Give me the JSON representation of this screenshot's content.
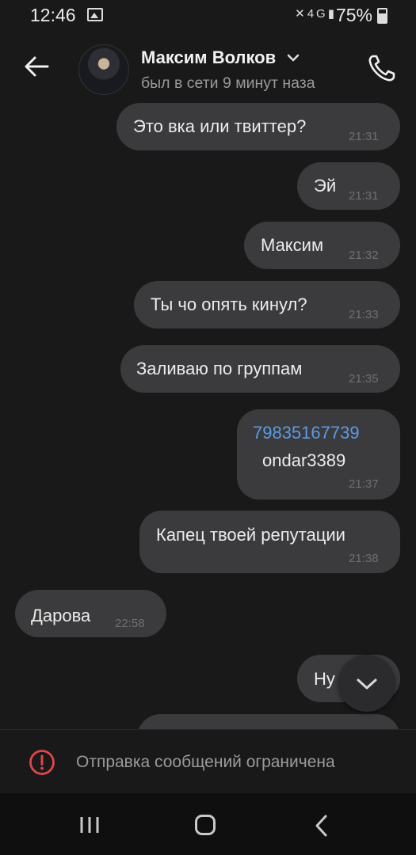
{
  "status_bar": {
    "time": "12:46",
    "network": "4G",
    "battery": "75%"
  },
  "header": {
    "contact_name": "Максим Волков",
    "contact_status": "был в сети 9 минут наза"
  },
  "messages": [
    {
      "text": "Это вка или твиттер?",
      "time": "21:31"
    },
    {
      "text": "Эй",
      "time": "21:31"
    },
    {
      "text": "Максим",
      "time": "21:32"
    },
    {
      "text": "Ты чо опять кинул?",
      "time": "21:33"
    },
    {
      "text": "Заливаю по группам",
      "time": "21:35"
    },
    {
      "link": "79835167739",
      "text": "ondar3389",
      "time": "21:37"
    },
    {
      "text": "Капец твоей репутации",
      "time": "21:38"
    },
    {
      "text": "Дарова",
      "time": "22:58"
    },
    {
      "text": "Ну"
    }
  ],
  "restriction": {
    "text": "Отправка сообщений ограничена"
  },
  "colors": {
    "background": "#19191a",
    "bubble": "#3b3b3d",
    "link": "#5b9be6",
    "warning": "#e0454b"
  }
}
